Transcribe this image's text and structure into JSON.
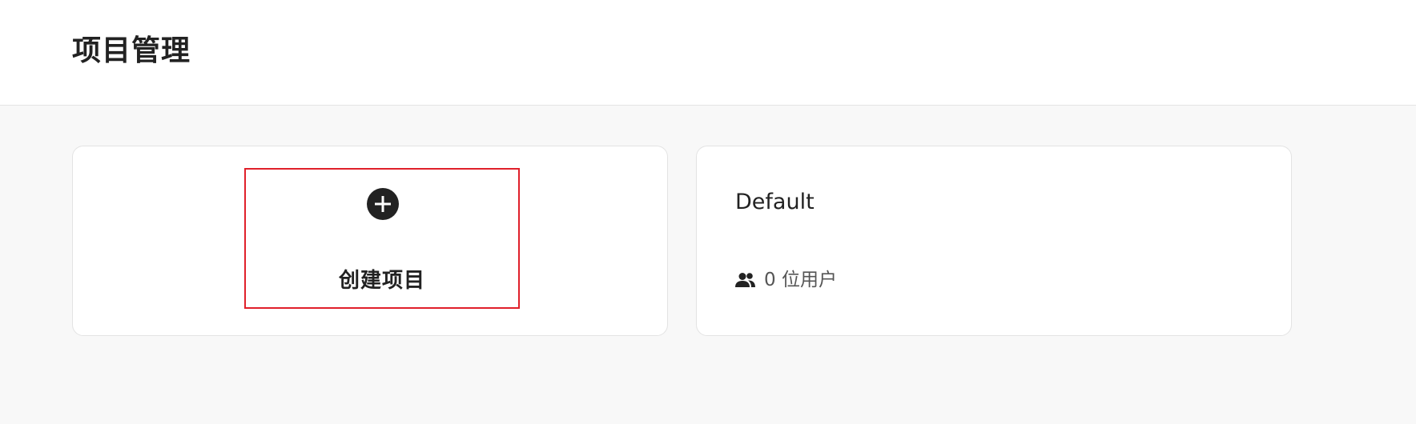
{
  "header": {
    "title": "项目管理"
  },
  "create_card": {
    "icon": "plus-circle-icon",
    "label": "创建项目",
    "highlight_color": "#e0202a"
  },
  "projects": [
    {
      "name": "Default",
      "members_icon": "users-icon",
      "members_text": "0 位用户"
    }
  ]
}
